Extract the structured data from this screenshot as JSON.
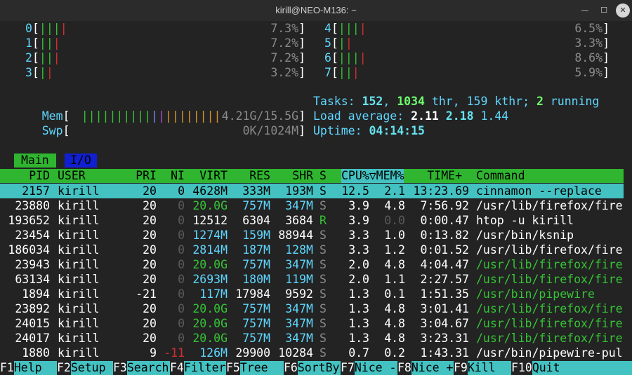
{
  "window": {
    "title": "kirill@NEO-M136: ~"
  },
  "cpus": [
    {
      "id": "0",
      "pct": "7.3%",
      "bars": [
        "g",
        "g",
        "g",
        "r"
      ]
    },
    {
      "id": "1",
      "pct": "7.2%",
      "bars": [
        "g",
        "g",
        "r"
      ]
    },
    {
      "id": "2",
      "pct": "7.2%",
      "bars": [
        "g",
        "g",
        "r"
      ]
    },
    {
      "id": "3",
      "pct": "3.2%",
      "bars": [
        "g",
        "r"
      ]
    },
    {
      "id": "4",
      "pct": "6.5%",
      "bars": [
        "g",
        "g",
        "g",
        "r"
      ]
    },
    {
      "id": "5",
      "pct": "3.3%",
      "bars": [
        "g",
        "r"
      ]
    },
    {
      "id": "6",
      "pct": "8.6%",
      "bars": [
        "g",
        "g",
        "g",
        "r"
      ]
    },
    {
      "id": "7",
      "pct": "5.9%",
      "bars": [
        "g",
        "g",
        "r"
      ]
    }
  ],
  "mem": {
    "label": "Mem",
    "value": "4.21G/15.5G"
  },
  "swp": {
    "label": "Swp",
    "value": "0K/1024M"
  },
  "tasks": {
    "label": "Tasks:",
    "count": "152",
    "thr": "1034",
    "thr_label": "thr,",
    "kthr": "159 kthr;",
    "running": "2",
    "running_label": "running"
  },
  "load": {
    "label": "Load average:",
    "v1": "2.11",
    "v2": "2.18",
    "v3": "1.44"
  },
  "uptime": {
    "label": "Uptime:",
    "value": "04:14:15"
  },
  "tabs": {
    "main": "Main",
    "io": "I/O"
  },
  "columns": [
    "PID",
    "USER",
    "PRI",
    "NI",
    "VIRT",
    "RES",
    "SHR",
    "S",
    "CPU%▽MEM%",
    "TIME+",
    "Command"
  ],
  "processes": [
    {
      "pid": "2157",
      "user": "kirill",
      "pri": "20",
      "ni": "0",
      "virt": "4628M",
      "res": "333M",
      "shr": "193M",
      "s": "S",
      "cpu": "12.5",
      "mem": "2.1",
      "time": "13:23.69",
      "cmd": "cinnamon --replace"
    },
    {
      "pid": "23880",
      "user": "kirill",
      "pri": "20",
      "ni": "0",
      "virt": "20.0G",
      "res": "757M",
      "shr": "347M",
      "s": "S",
      "cpu": "3.9",
      "mem": "4.8",
      "time": "7:56.92",
      "cmd": "/usr/lib/firefox/fire"
    },
    {
      "pid": "193652",
      "user": "kirill",
      "pri": "20",
      "ni": "0",
      "virt": "12512",
      "res": "6304",
      "shr": "3684",
      "s": "R",
      "cpu": "3.9",
      "mem": "0.0",
      "time": "0:00.47",
      "cmd": "htop -u kirill"
    },
    {
      "pid": "23454",
      "user": "kirill",
      "pri": "20",
      "ni": "0",
      "virt": "1274M",
      "res": "159M",
      "shr": "88944",
      "s": "S",
      "cpu": "3.3",
      "mem": "1.0",
      "time": "0:13.82",
      "cmd": "/usr/bin/ksnip"
    },
    {
      "pid": "186034",
      "user": "kirill",
      "pri": "20",
      "ni": "0",
      "virt": "2814M",
      "res": "187M",
      "shr": "128M",
      "s": "S",
      "cpu": "3.3",
      "mem": "1.2",
      "time": "0:01.52",
      "cmd": "/usr/lib/firefox/fire"
    },
    {
      "pid": "23943",
      "user": "kirill",
      "pri": "20",
      "ni": "0",
      "virt": "20.0G",
      "res": "757M",
      "shr": "347M",
      "s": "S",
      "cpu": "2.0",
      "mem": "4.8",
      "time": "4:04.47",
      "cmd": "/usr/lib/firefox/fire"
    },
    {
      "pid": "63134",
      "user": "kirill",
      "pri": "20",
      "ni": "0",
      "virt": "2693M",
      "res": "180M",
      "shr": "119M",
      "s": "S",
      "cpu": "2.0",
      "mem": "1.1",
      "time": "2:27.57",
      "cmd": "/usr/lib/firefox/fire"
    },
    {
      "pid": "1894",
      "user": "kirill",
      "pri": "-21",
      "ni": "0",
      "virt": "117M",
      "res": "17984",
      "shr": "9592",
      "s": "S",
      "cpu": "1.3",
      "mem": "0.1",
      "time": "1:51.35",
      "cmd": "/usr/bin/pipewire"
    },
    {
      "pid": "23892",
      "user": "kirill",
      "pri": "20",
      "ni": "0",
      "virt": "20.0G",
      "res": "757M",
      "shr": "347M",
      "s": "S",
      "cpu": "1.3",
      "mem": "4.8",
      "time": "3:01.41",
      "cmd": "/usr/lib/firefox/fire"
    },
    {
      "pid": "24015",
      "user": "kirill",
      "pri": "20",
      "ni": "0",
      "virt": "20.0G",
      "res": "757M",
      "shr": "347M",
      "s": "S",
      "cpu": "1.3",
      "mem": "4.8",
      "time": "3:04.67",
      "cmd": "/usr/lib/firefox/fire"
    },
    {
      "pid": "24017",
      "user": "kirill",
      "pri": "20",
      "ni": "0",
      "virt": "20.0G",
      "res": "757M",
      "shr": "347M",
      "s": "S",
      "cpu": "1.3",
      "mem": "4.8",
      "time": "3:23.31",
      "cmd": "/usr/lib/firefox/fire"
    },
    {
      "pid": "1880",
      "user": "kirill",
      "pri": "9",
      "ni": "-11",
      "virt": "126M",
      "res": "29900",
      "shr": "10284",
      "s": "S",
      "cpu": "0.7",
      "mem": "0.2",
      "time": "1:43.31",
      "cmd": "/usr/bin/pipewire-pul"
    }
  ],
  "fkeys": [
    {
      "k": "F1",
      "l": "Help"
    },
    {
      "k": "F2",
      "l": "Setup"
    },
    {
      "k": "F3",
      "l": "Search"
    },
    {
      "k": "F4",
      "l": "Filter"
    },
    {
      "k": "F5",
      "l": "Tree"
    },
    {
      "k": "F6",
      "l": "SortBy"
    },
    {
      "k": "F7",
      "l": "Nice -"
    },
    {
      "k": "F8",
      "l": "Nice +"
    },
    {
      "k": "F9",
      "l": "Kill"
    },
    {
      "k": "F10",
      "l": "Quit"
    }
  ],
  "colors": {
    "bar_green": "#35c435",
    "bar_red": "#d03030",
    "selection": "#44c2c2",
    "header": "#2fb52f"
  }
}
